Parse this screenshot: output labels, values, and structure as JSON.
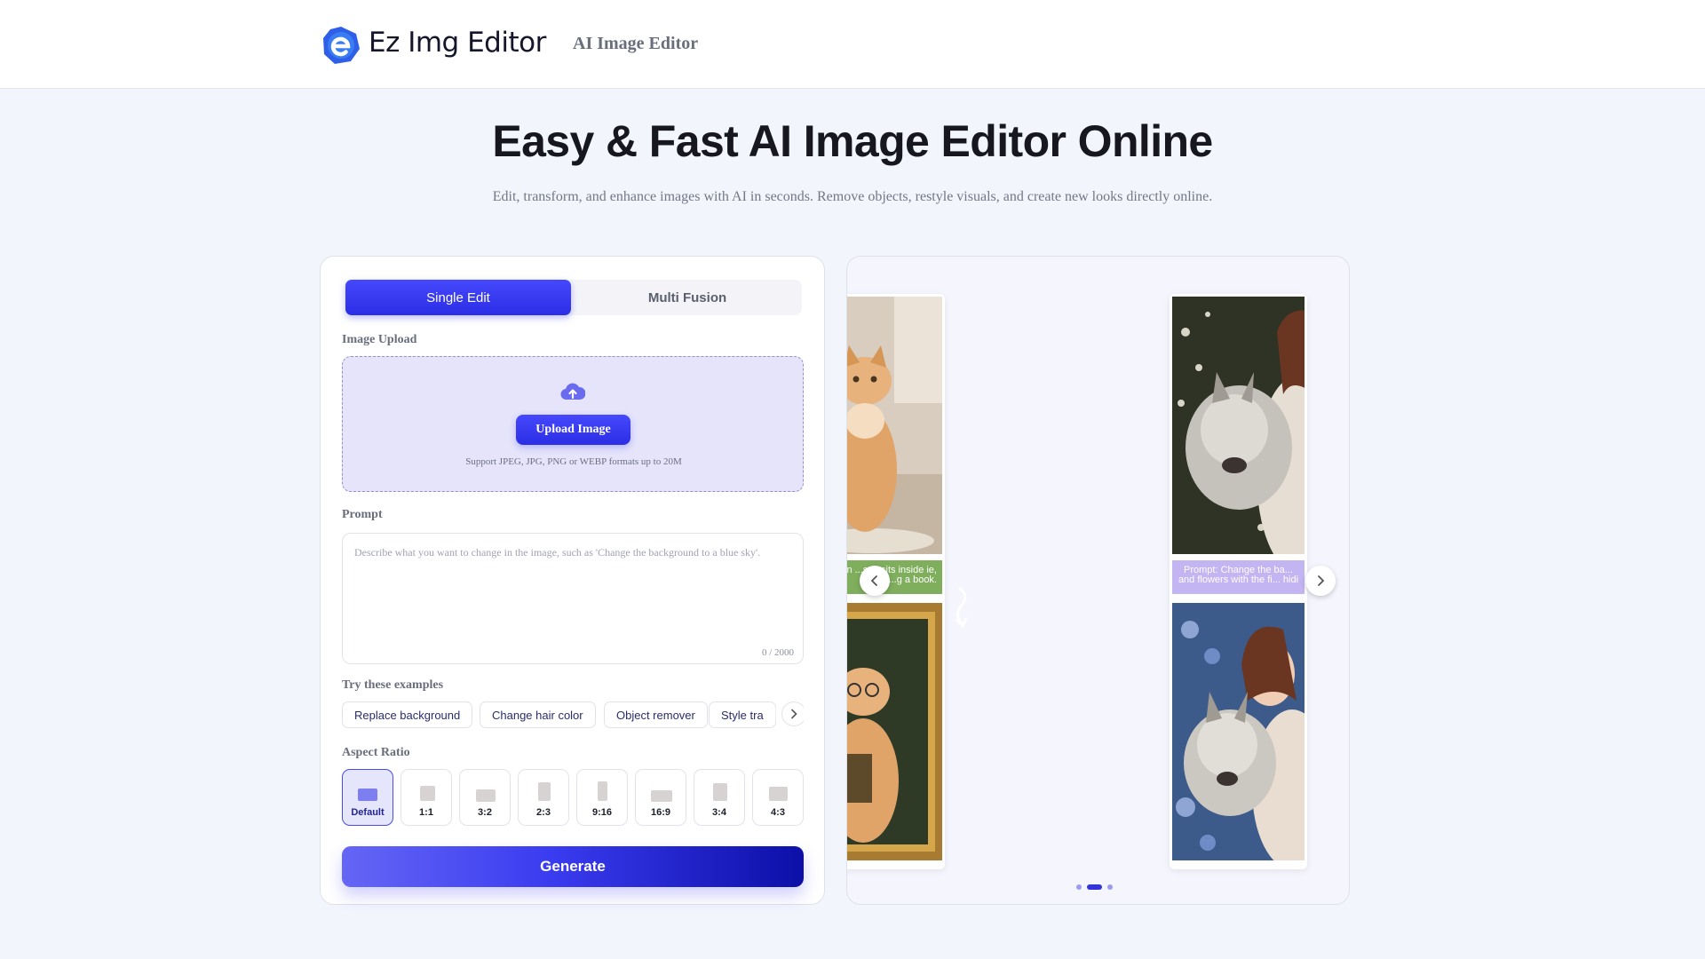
{
  "header": {
    "brand": "Ez Img Editor",
    "nav_link": "AI Image Editor"
  },
  "hero": {
    "title": "Easy & Fast AI Image Editor Online",
    "subtitle": "Edit, transform, and enhance images with AI in seconds. Remove objects, restyle visuals, and create new looks directly online."
  },
  "tabs": [
    {
      "label": "Single Edit",
      "active": true
    },
    {
      "label": "Multi Fusion",
      "active": false
    }
  ],
  "upload": {
    "section_label": "Image Upload",
    "button_label": "Upload Image",
    "note": "Support JPEG, JPG, PNG or WEBP formats up to 20M"
  },
  "prompt": {
    "section_label": "Prompt",
    "placeholder": "Describe what you want to change in the image, such as 'Change the background to a blue sky'.",
    "counter": "0 / 2000"
  },
  "examples": {
    "section_label": "Try these examples",
    "chips": [
      "Replace background",
      "Change hair color",
      "Object remover",
      "Style tra"
    ]
  },
  "aspect_ratio": {
    "section_label": "Aspect Ratio",
    "options": [
      "Default",
      "1:1",
      "3:2",
      "2:3",
      "9:16",
      "16:9",
      "3:4",
      "4:3"
    ],
    "selected": "Default"
  },
  "generate_label": "Generate",
  "showcase": {
    "cards": [
      {
        "prompt": "Prompt: A Persian cat with glasses sits inside an ornate golden frame, holding a book."
      },
      {
        "prompt": "Prompt: Change the background to blue flowers with the figure hiding"
      }
    ],
    "visible_prompts": [
      "arian ...ses sits inside ie, ...g a book.",
      "Prompt: Change the ba... and flowers with the fi... hidi"
    ],
    "pagination": {
      "count": 3,
      "active": 2
    }
  },
  "colors": {
    "accent": "#3a3cf0",
    "page_bg": "#f2f5fc",
    "upload_bg": "#e5e4fb",
    "cat_caption_bg": "#7fae5d",
    "wolf_caption_bg": "#c3b4f2"
  },
  "icons": [
    "logo-icon",
    "cloud-upload-icon",
    "chevron-right-icon",
    "chevron-left-icon"
  ]
}
